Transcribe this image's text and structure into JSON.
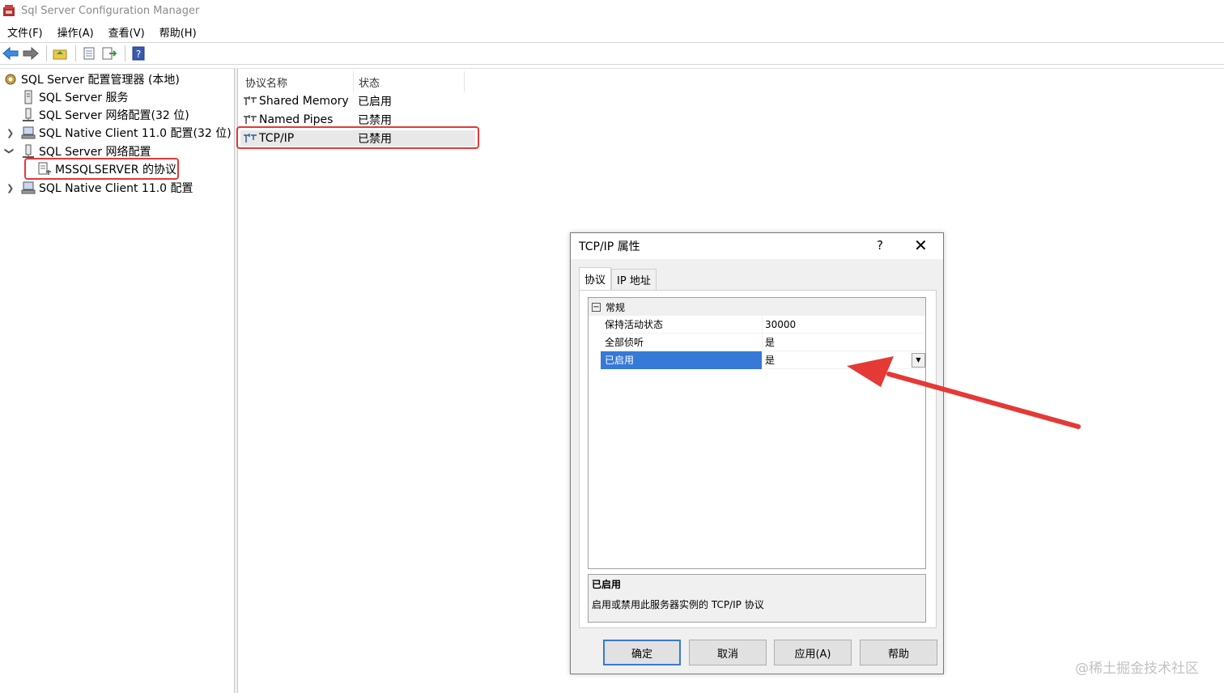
{
  "window": {
    "title": "Sql Server Configuration Manager"
  },
  "menu": [
    {
      "label": "文件(F)"
    },
    {
      "label": "操作(A)"
    },
    {
      "label": "查看(V)"
    },
    {
      "label": "帮助(H)"
    }
  ],
  "tree": {
    "root": "SQL Server 配置管理器 (本地)",
    "items": [
      {
        "label": "SQL Server 服务"
      },
      {
        "label": "SQL Server 网络配置(32 位)"
      },
      {
        "label": "SQL Native Client 11.0 配置(32 位)"
      },
      {
        "label": "SQL Server 网络配置"
      },
      {
        "label": "MSSQLSERVER 的协议"
      },
      {
        "label": "SQL Native Client 11.0 配置"
      }
    ]
  },
  "list": {
    "headers": {
      "name": "协议名称",
      "status": "状态"
    },
    "rows": [
      {
        "name": "Shared Memory",
        "status": "已启用"
      },
      {
        "name": "Named Pipes",
        "status": "已禁用"
      },
      {
        "name": "TCP/IP",
        "status": "已禁用"
      }
    ]
  },
  "dialog": {
    "title": "TCP/IP 属性",
    "help": "?",
    "close": "✕",
    "tabs": [
      {
        "label": "协议"
      },
      {
        "label": "IP 地址"
      }
    ],
    "category": "常规",
    "expander": "−",
    "properties": [
      {
        "key": "保持活动状态",
        "value": "30000"
      },
      {
        "key": "全部侦听",
        "value": "是"
      },
      {
        "key": "已启用",
        "value": "是"
      }
    ],
    "description": {
      "title": "已启用",
      "text": "启用或禁用此服务器实例的 TCP/IP 协议"
    },
    "buttons": {
      "ok": "确定",
      "cancel": "取消",
      "apply": "应用(A)",
      "help": "帮助"
    }
  },
  "watermark": "@稀土掘金技术社区",
  "colors": {
    "highlight": "#e53935",
    "selection": "#3679d7"
  }
}
